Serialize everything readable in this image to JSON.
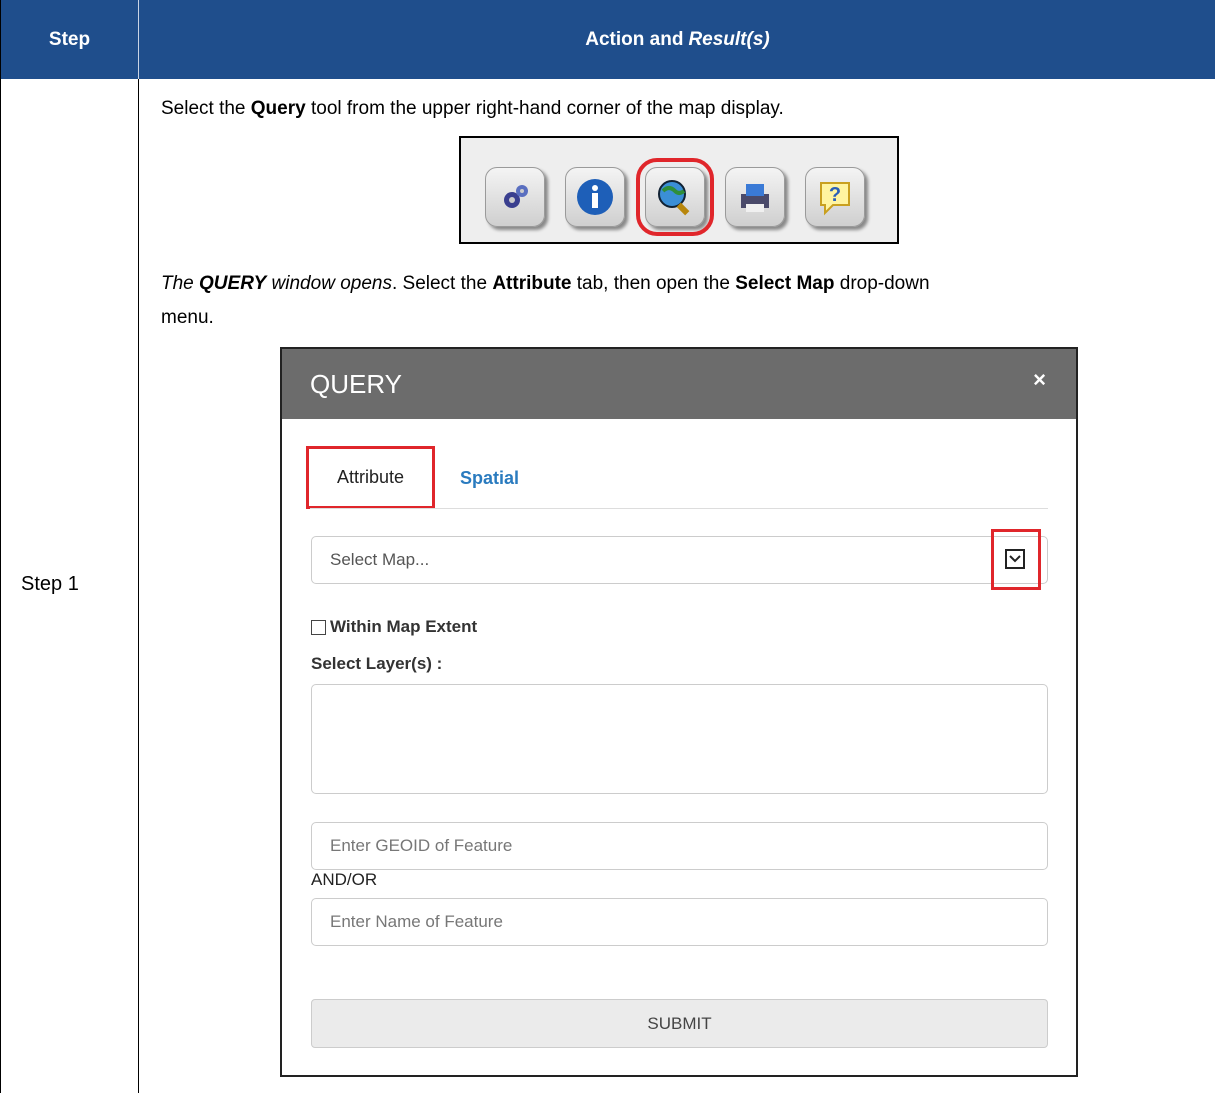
{
  "table": {
    "header_step": "Step",
    "header_action": "Action and",
    "header_result": "Result(s)",
    "step_label": "Step 1"
  },
  "instructions": {
    "line1_pre": "Select the ",
    "line1_bold": "Query",
    "line1_post": " tool from the upper right-hand corner of the map display.",
    "line2_italic_pre": "The ",
    "line2_bold_italic": "QUERY",
    "line2_italic_post": " window opens",
    "line2_a": ". Select the ",
    "line2_bold_attr": "Attribute",
    "line2_b": " tab, then open the ",
    "line2_bold_select": "Select Map",
    "line2_c": " drop-down",
    "line3": "menu."
  },
  "toolbar": {
    "buttons": [
      "settings-icon",
      "info-icon",
      "query-icon",
      "print-icon",
      "help-icon"
    ],
    "highlighted": "query-icon"
  },
  "dialog": {
    "title": "QUERY",
    "close": "×",
    "tab_attribute": "Attribute",
    "tab_spatial": "Spatial",
    "select_map_placeholder": "Select Map...",
    "within_map_extent": "Within Map Extent",
    "select_layers_label": "Select Layer(s) :",
    "geoid_placeholder": "Enter GEOID of Feature",
    "andor": "AND/OR",
    "name_placeholder": "Enter Name of Feature",
    "submit": "SUBMIT"
  },
  "colors": {
    "header_bg": "#1f4e8c",
    "highlight": "#e0262b",
    "dialog_title_bg": "#6c6c6c",
    "spatial_tab": "#2a7bbf"
  }
}
